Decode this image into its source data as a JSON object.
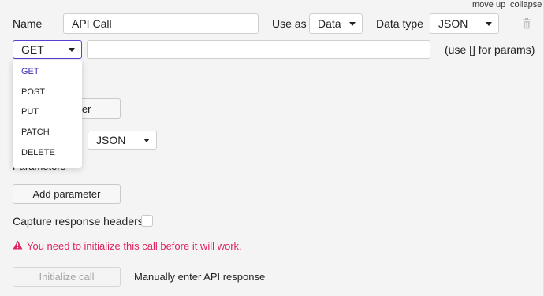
{
  "top_links": {
    "move_up": "move up",
    "collapse": "collapse"
  },
  "row1": {
    "name_label": "Name",
    "name_value": "API Call",
    "use_as_label": "Use as",
    "use_as_value": "Data",
    "data_type_label": "Data type",
    "data_type_value": "JSON"
  },
  "method": {
    "selected": "GET",
    "url_value": "",
    "hint": "(use [] for params)",
    "options": [
      "GET",
      "POST",
      "PUT",
      "PATCH",
      "DELETE"
    ]
  },
  "header_button_partial": "ler",
  "body_type_value": "JSON",
  "parameters_label": "Parameters",
  "add_parameter_label": "Add parameter",
  "capture_headers_label": "Capture response headers",
  "warning_text": "You need to initialize this call before it will work.",
  "initialize_label": "Initialize call",
  "manual_label": "Manually enter API response",
  "colors": {
    "accent": "#5a3fd6",
    "warning": "#e0245e"
  }
}
